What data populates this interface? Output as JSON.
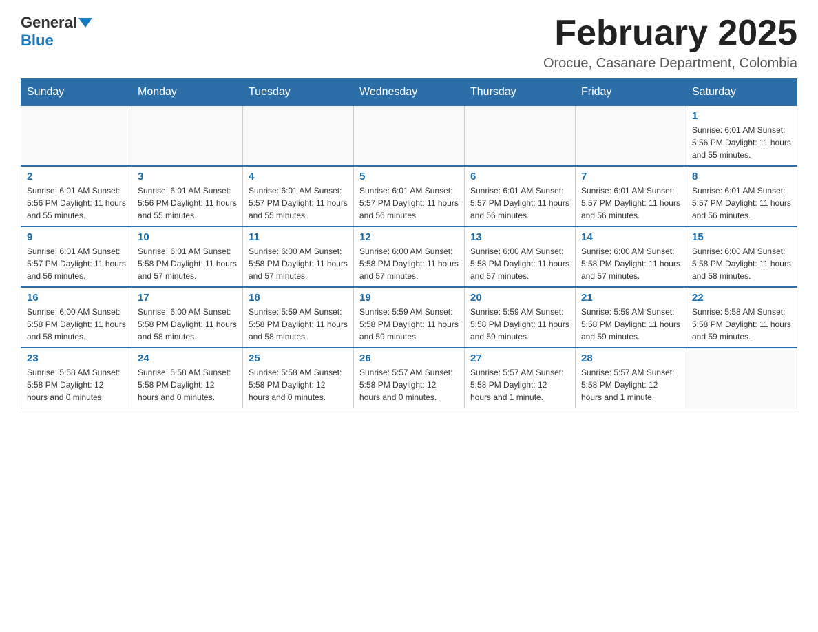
{
  "header": {
    "logo_general": "General",
    "logo_blue": "Blue",
    "month_title": "February 2025",
    "location": "Orocue, Casanare Department, Colombia"
  },
  "weekdays": [
    "Sunday",
    "Monday",
    "Tuesday",
    "Wednesday",
    "Thursday",
    "Friday",
    "Saturday"
  ],
  "weeks": [
    [
      {
        "day": "",
        "info": ""
      },
      {
        "day": "",
        "info": ""
      },
      {
        "day": "",
        "info": ""
      },
      {
        "day": "",
        "info": ""
      },
      {
        "day": "",
        "info": ""
      },
      {
        "day": "",
        "info": ""
      },
      {
        "day": "1",
        "info": "Sunrise: 6:01 AM\nSunset: 5:56 PM\nDaylight: 11 hours\nand 55 minutes."
      }
    ],
    [
      {
        "day": "2",
        "info": "Sunrise: 6:01 AM\nSunset: 5:56 PM\nDaylight: 11 hours\nand 55 minutes."
      },
      {
        "day": "3",
        "info": "Sunrise: 6:01 AM\nSunset: 5:56 PM\nDaylight: 11 hours\nand 55 minutes."
      },
      {
        "day": "4",
        "info": "Sunrise: 6:01 AM\nSunset: 5:57 PM\nDaylight: 11 hours\nand 55 minutes."
      },
      {
        "day": "5",
        "info": "Sunrise: 6:01 AM\nSunset: 5:57 PM\nDaylight: 11 hours\nand 56 minutes."
      },
      {
        "day": "6",
        "info": "Sunrise: 6:01 AM\nSunset: 5:57 PM\nDaylight: 11 hours\nand 56 minutes."
      },
      {
        "day": "7",
        "info": "Sunrise: 6:01 AM\nSunset: 5:57 PM\nDaylight: 11 hours\nand 56 minutes."
      },
      {
        "day": "8",
        "info": "Sunrise: 6:01 AM\nSunset: 5:57 PM\nDaylight: 11 hours\nand 56 minutes."
      }
    ],
    [
      {
        "day": "9",
        "info": "Sunrise: 6:01 AM\nSunset: 5:57 PM\nDaylight: 11 hours\nand 56 minutes."
      },
      {
        "day": "10",
        "info": "Sunrise: 6:01 AM\nSunset: 5:58 PM\nDaylight: 11 hours\nand 57 minutes."
      },
      {
        "day": "11",
        "info": "Sunrise: 6:00 AM\nSunset: 5:58 PM\nDaylight: 11 hours\nand 57 minutes."
      },
      {
        "day": "12",
        "info": "Sunrise: 6:00 AM\nSunset: 5:58 PM\nDaylight: 11 hours\nand 57 minutes."
      },
      {
        "day": "13",
        "info": "Sunrise: 6:00 AM\nSunset: 5:58 PM\nDaylight: 11 hours\nand 57 minutes."
      },
      {
        "day": "14",
        "info": "Sunrise: 6:00 AM\nSunset: 5:58 PM\nDaylight: 11 hours\nand 57 minutes."
      },
      {
        "day": "15",
        "info": "Sunrise: 6:00 AM\nSunset: 5:58 PM\nDaylight: 11 hours\nand 58 minutes."
      }
    ],
    [
      {
        "day": "16",
        "info": "Sunrise: 6:00 AM\nSunset: 5:58 PM\nDaylight: 11 hours\nand 58 minutes."
      },
      {
        "day": "17",
        "info": "Sunrise: 6:00 AM\nSunset: 5:58 PM\nDaylight: 11 hours\nand 58 minutes."
      },
      {
        "day": "18",
        "info": "Sunrise: 5:59 AM\nSunset: 5:58 PM\nDaylight: 11 hours\nand 58 minutes."
      },
      {
        "day": "19",
        "info": "Sunrise: 5:59 AM\nSunset: 5:58 PM\nDaylight: 11 hours\nand 59 minutes."
      },
      {
        "day": "20",
        "info": "Sunrise: 5:59 AM\nSunset: 5:58 PM\nDaylight: 11 hours\nand 59 minutes."
      },
      {
        "day": "21",
        "info": "Sunrise: 5:59 AM\nSunset: 5:58 PM\nDaylight: 11 hours\nand 59 minutes."
      },
      {
        "day": "22",
        "info": "Sunrise: 5:58 AM\nSunset: 5:58 PM\nDaylight: 11 hours\nand 59 minutes."
      }
    ],
    [
      {
        "day": "23",
        "info": "Sunrise: 5:58 AM\nSunset: 5:58 PM\nDaylight: 12 hours\nand 0 minutes."
      },
      {
        "day": "24",
        "info": "Sunrise: 5:58 AM\nSunset: 5:58 PM\nDaylight: 12 hours\nand 0 minutes."
      },
      {
        "day": "25",
        "info": "Sunrise: 5:58 AM\nSunset: 5:58 PM\nDaylight: 12 hours\nand 0 minutes."
      },
      {
        "day": "26",
        "info": "Sunrise: 5:57 AM\nSunset: 5:58 PM\nDaylight: 12 hours\nand 0 minutes."
      },
      {
        "day": "27",
        "info": "Sunrise: 5:57 AM\nSunset: 5:58 PM\nDaylight: 12 hours\nand 1 minute."
      },
      {
        "day": "28",
        "info": "Sunrise: 5:57 AM\nSunset: 5:58 PM\nDaylight: 12 hours\nand 1 minute."
      },
      {
        "day": "",
        "info": ""
      }
    ]
  ]
}
